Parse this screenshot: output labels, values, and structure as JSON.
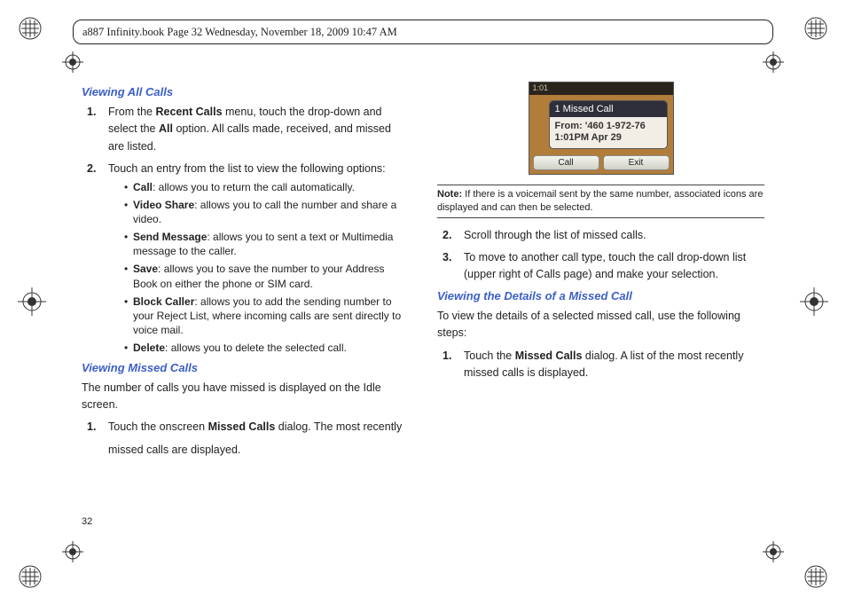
{
  "header": "a887 Infinity.book  Page 32  Wednesday, November 18, 2009  10:47 AM",
  "page_number": "32",
  "col_left": {
    "sec1_title": "Viewing All Calls",
    "sec1_step1_num": "1.",
    "sec1_step1_a": "From the ",
    "sec1_step1_b": "Recent Calls",
    "sec1_step1_c": " menu, touch the drop-down and select the ",
    "sec1_step1_d": "All",
    "sec1_step1_e": " option. All calls made, received, and missed are listed.",
    "sec1_step2_num": "2.",
    "sec1_step2": "Touch an entry from the list to view the following options:",
    "bullets": {
      "b1_a": "Call",
      "b1_b": ": allows you to return the call automatically.",
      "b2_a": "Video Share",
      "b2_b": ": allows you to call the number and share a video.",
      "b3_a": "Send Message",
      "b3_b": ": allows you to sent a text or Multimedia message to the caller.",
      "b4_a": "Save",
      "b4_b": ": allows you to save the number to your Address Book on either the phone or SIM card.",
      "b5_a": "Block Caller",
      "b5_b": ": allows you to add the sending number to your Reject List, where incoming calls are sent directly to voice mail.",
      "b6_a": "Delete",
      "b6_b": ": allows you to delete the selected call."
    },
    "sec2_title": "Viewing Missed Calls",
    "sec2_intro": "The number of calls you have missed is displayed on the Idle screen.",
    "sec2_step1_num": "1.",
    "sec2_step1_a": "Touch the onscreen ",
    "sec2_step1_b": "Missed Calls",
    "sec2_step1_c": " dialog. The most recently"
  },
  "col_right": {
    "continuation": "missed calls are displayed.",
    "phone": {
      "status_time": "1:01",
      "dialog_title": "1 Missed Call",
      "dialog_line1": "From: '460   1-972-76",
      "dialog_line2": "1:01PM Apr 29",
      "soft_left": "Call",
      "soft_right": "Exit"
    },
    "note_label": "Note:",
    "note_text": " If there is a voicemail sent by the same number, associated icons are displayed and can then be selected.",
    "step2_num": "2.",
    "step2": "Scroll through the list of missed calls.",
    "step3_num": "3.",
    "step3": "To move to another call type, touch the call drop-down list (upper right of Calls page) and make your selection.",
    "sec3_title": "Viewing the Details of a Missed Call",
    "sec3_intro": "To view the details of a selected missed call, use the following steps:",
    "sec3_step1_num": "1.",
    "sec3_step1_a": "Touch the ",
    "sec3_step1_b": "Missed Calls",
    "sec3_step1_c": " dialog. A list of the most recently missed calls is displayed."
  }
}
